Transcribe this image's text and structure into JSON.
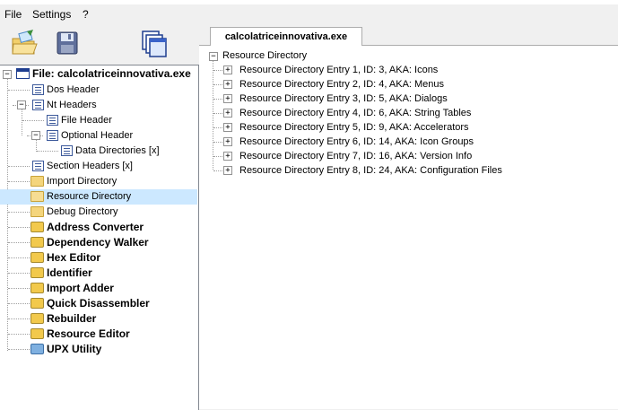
{
  "menu": {
    "file": "File",
    "settings": "Settings",
    "help": "?"
  },
  "toolbar": [
    {
      "icon": "open-file-icon"
    },
    {
      "icon": "save-disk-icon"
    },
    {
      "icon": "windows-icon"
    }
  ],
  "tree": {
    "root_label": "File: calcolatriceinnovativa.exe",
    "dos_header": "Dos Header",
    "nt_headers": "Nt Headers",
    "file_header": "File Header",
    "optional_header": "Optional Header",
    "data_directories": "Data Directories [x]",
    "section_headers": "Section Headers [x]",
    "import_directory": "Import Directory",
    "resource_directory": "Resource Directory",
    "debug_directory": "Debug Directory",
    "tools": [
      "Address Converter",
      "Dependency Walker",
      "Hex Editor",
      "Identifier",
      "Import Adder",
      "Quick Disassembler",
      "Rebuilder",
      "Resource Editor",
      "UPX Utility"
    ]
  },
  "tab": {
    "label": "calcolatriceinnovativa.exe"
  },
  "resource_tree": {
    "root": "Resource Directory",
    "entries": [
      "Resource Directory Entry 1, ID: 3, AKA: Icons",
      "Resource Directory Entry 2, ID: 4, AKA: Menus",
      "Resource Directory Entry 3, ID: 5, AKA: Dialogs",
      "Resource Directory Entry 4, ID: 6, AKA: String Tables",
      "Resource Directory Entry 5, ID: 9, AKA: Accelerators",
      "Resource Directory Entry 6, ID: 14, AKA: Icon Groups",
      "Resource Directory Entry 7, ID: 16, AKA: Version Info",
      "Resource Directory Entry 8, ID: 24, AKA: Configuration Files"
    ]
  }
}
